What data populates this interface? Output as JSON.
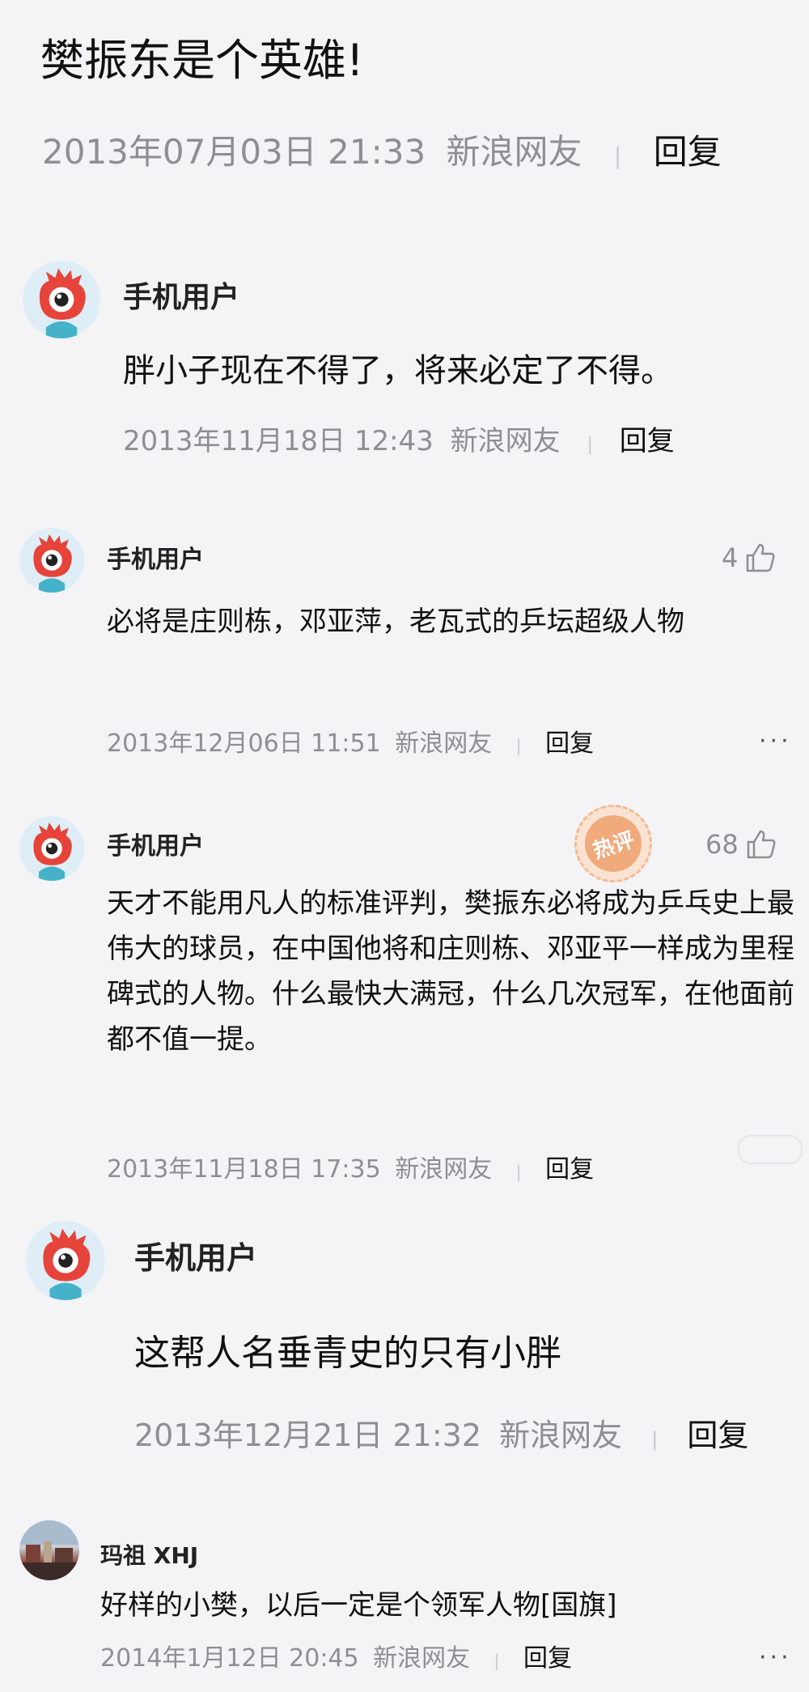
{
  "post": {
    "title": "樊振东是个英雄!",
    "date": "2013年07月03日 21:33",
    "source": "新浪网友",
    "reply_label": "回复"
  },
  "comments": [
    {
      "user": "手机用户",
      "text": "胖小子现在不得了，将来必定了不得。",
      "date": "2013年11月18日 12:43",
      "source": "新浪网友",
      "reply_label": "回复",
      "avatar_icon": "sina-eye-icon"
    },
    {
      "user": "手机用户",
      "text": "必将是庄则栋，邓亚萍，老瓦式的乒坛超级人物",
      "date": "2013年12月06日 11:51",
      "source": "新浪网友",
      "reply_label": "回复",
      "likes": "4",
      "more": "···",
      "avatar_icon": "sina-eye-icon"
    },
    {
      "user": "手机用户",
      "text": "天才不能用凡人的标准评判，樊振东必将成为乒乓史上最伟大的球员，在中国他将和庄则栋、邓亚平一样成为里程碑式的人物。什么最快大满冠，什么几次冠军，在他面前都不值一提。",
      "date": "2013年11月18日 17:35",
      "source": "新浪网友",
      "reply_label": "回复",
      "likes": "68",
      "badge": "热评",
      "avatar_icon": "sina-eye-icon"
    },
    {
      "user": "手机用户",
      "text": "这帮人名垂青史的只有小胖",
      "date": "2013年12月21日 21:32",
      "source": "新浪网友",
      "reply_label": "回复",
      "avatar_icon": "sina-eye-icon"
    },
    {
      "user": "玛祖 XHJ",
      "text": "好样的小樊，以后一定是个领军人物[国旗]",
      "date": "2014年1月12日 20:45",
      "source": "新浪网友",
      "reply_label": "回复",
      "more": "···",
      "avatar_icon": "photo-avatar"
    }
  ],
  "colors": {
    "background": "#f4f4f6",
    "meta_text": "#8e8e93",
    "avatar_red": "#e6443a",
    "badge_orange": "#f0a36e"
  }
}
